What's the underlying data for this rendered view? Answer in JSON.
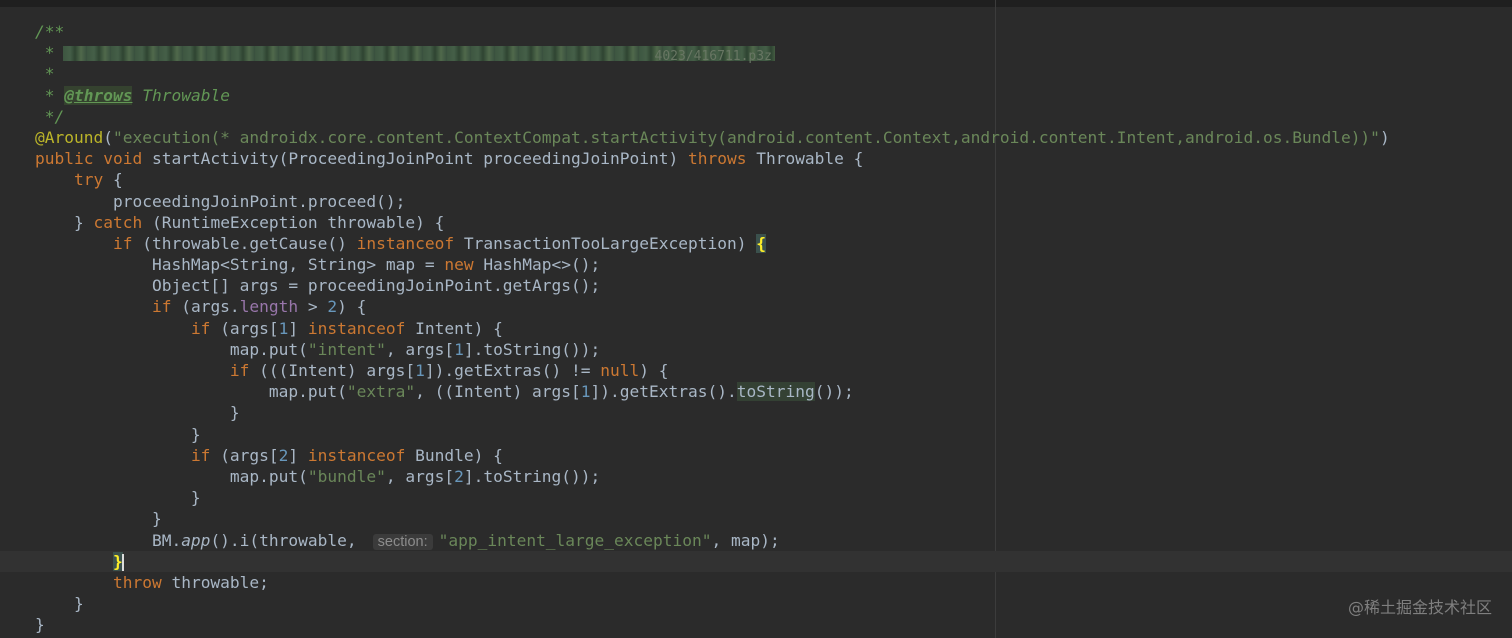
{
  "editor": {
    "lines": [
      {
        "parts": [
          {
            "t": "/**",
            "c": "cm"
          }
        ]
      },
      {
        "parts": [
          {
            "t": " *",
            "c": "cm"
          },
          {
            "blur": true,
            "t": "4023/416711.p3z"
          }
        ]
      },
      {
        "parts": [
          {
            "t": " *",
            "c": "cm"
          }
        ]
      },
      {
        "parts": [
          {
            "t": " * ",
            "c": "cm"
          },
          {
            "t": "@throws",
            "c": "tag"
          },
          {
            "t": " Throwable",
            "c": "cm"
          }
        ]
      },
      {
        "parts": [
          {
            "t": " */",
            "c": "cm"
          }
        ]
      },
      {
        "parts": [
          {
            "t": "@Around",
            "c": "ann"
          },
          {
            "t": "("
          },
          {
            "t": "\"execution(* androidx.core.content.ContextCompat.startActivity(android.content.Context,android.content.Intent,android.os.Bundle))\"",
            "c": "str"
          },
          {
            "t": ")"
          }
        ]
      },
      {
        "parts": [
          {
            "t": "public void ",
            "c": "kw"
          },
          {
            "t": "startActivity(ProceedingJoinPoint proceedingJoinPoint) "
          },
          {
            "t": "throws ",
            "c": "kw"
          },
          {
            "t": "Throwable {"
          }
        ]
      },
      {
        "parts": [
          {
            "t": "    "
          },
          {
            "t": "try ",
            "c": "kw"
          },
          {
            "t": "{"
          }
        ]
      },
      {
        "parts": [
          {
            "t": "        proceedingJoinPoint.proceed();"
          }
        ]
      },
      {
        "parts": [
          {
            "t": "    } "
          },
          {
            "t": "catch ",
            "c": "kw"
          },
          {
            "t": "(RuntimeException throwable) {"
          }
        ]
      },
      {
        "parts": [
          {
            "t": "        "
          },
          {
            "t": "if ",
            "c": "kw"
          },
          {
            "t": "(throwable.getCause() "
          },
          {
            "t": "instanceof ",
            "c": "kw"
          },
          {
            "t": "TransactionTooLargeException) "
          },
          {
            "t": "{",
            "c": "brace-match"
          }
        ]
      },
      {
        "parts": [
          {
            "t": "            HashMap<String, String> map = "
          },
          {
            "t": "new ",
            "c": "kw"
          },
          {
            "t": "HashMap<>();"
          }
        ]
      },
      {
        "parts": [
          {
            "t": "            Object[] args = proceedingJoinPoint.getArgs();"
          }
        ]
      },
      {
        "parts": [
          {
            "t": "            "
          },
          {
            "t": "if ",
            "c": "kw"
          },
          {
            "t": "(args."
          },
          {
            "t": "length",
            "c": "fld"
          },
          {
            "t": " > "
          },
          {
            "t": "2",
            "c": "num"
          },
          {
            "t": ") {"
          }
        ]
      },
      {
        "parts": [
          {
            "t": "                "
          },
          {
            "t": "if ",
            "c": "kw"
          },
          {
            "t": "(args["
          },
          {
            "t": "1",
            "c": "num"
          },
          {
            "t": "] "
          },
          {
            "t": "instanceof ",
            "c": "kw"
          },
          {
            "t": "Intent) {"
          }
        ]
      },
      {
        "parts": [
          {
            "t": "                    map.put("
          },
          {
            "t": "\"intent\"",
            "c": "str"
          },
          {
            "t": ", args["
          },
          {
            "t": "1",
            "c": "num"
          },
          {
            "t": "].toString());"
          }
        ]
      },
      {
        "parts": [
          {
            "t": "                    "
          },
          {
            "t": "if ",
            "c": "kw"
          },
          {
            "t": "(((Intent) args["
          },
          {
            "t": "1",
            "c": "num"
          },
          {
            "t": "]).getExtras() != "
          },
          {
            "t": "null",
            "c": "kw"
          },
          {
            "t": ") {"
          }
        ]
      },
      {
        "parts": [
          {
            "t": "                        map.put("
          },
          {
            "t": "\"extra\"",
            "c": "str"
          },
          {
            "t": ", ((Intent) args["
          },
          {
            "t": "1",
            "c": "num"
          },
          {
            "t": "]).getExtras()."
          },
          {
            "t": "toString",
            "c": "hl"
          },
          {
            "t": "());"
          }
        ]
      },
      {
        "parts": [
          {
            "t": "                    }"
          }
        ]
      },
      {
        "parts": [
          {
            "t": "                }"
          }
        ]
      },
      {
        "parts": [
          {
            "t": "                "
          },
          {
            "t": "if ",
            "c": "kw"
          },
          {
            "t": "(args["
          },
          {
            "t": "2",
            "c": "num"
          },
          {
            "t": "] "
          },
          {
            "t": "instanceof ",
            "c": "kw"
          },
          {
            "t": "Bundle) {"
          }
        ]
      },
      {
        "parts": [
          {
            "t": "                    map.put("
          },
          {
            "t": "\"bundle\"",
            "c": "str"
          },
          {
            "t": ", args["
          },
          {
            "t": "2",
            "c": "num"
          },
          {
            "t": "].toString());"
          }
        ]
      },
      {
        "parts": [
          {
            "t": "                }"
          }
        ]
      },
      {
        "parts": [
          {
            "t": "            }"
          }
        ]
      },
      {
        "parts": [
          {
            "t": "            BM."
          },
          {
            "t": "app",
            "c": "it"
          },
          {
            "t": "().i(throwable,"
          },
          {
            "hint": "section:"
          },
          {
            "t": "\"app_intent_large_exception\"",
            "c": "str"
          },
          {
            "t": ", map);"
          }
        ]
      },
      {
        "caret_line": true,
        "parts": [
          {
            "t": "        "
          },
          {
            "t": "}",
            "c": "brace-match"
          },
          {
            "caret": true
          }
        ]
      },
      {
        "parts": [
          {
            "t": "        "
          },
          {
            "t": "throw ",
            "c": "kw"
          },
          {
            "t": "throwable;"
          }
        ]
      },
      {
        "parts": [
          {
            "t": "    }"
          }
        ]
      },
      {
        "parts": [
          {
            "t": "}"
          }
        ]
      }
    ]
  },
  "watermark": "@稀土掘金技术社区"
}
